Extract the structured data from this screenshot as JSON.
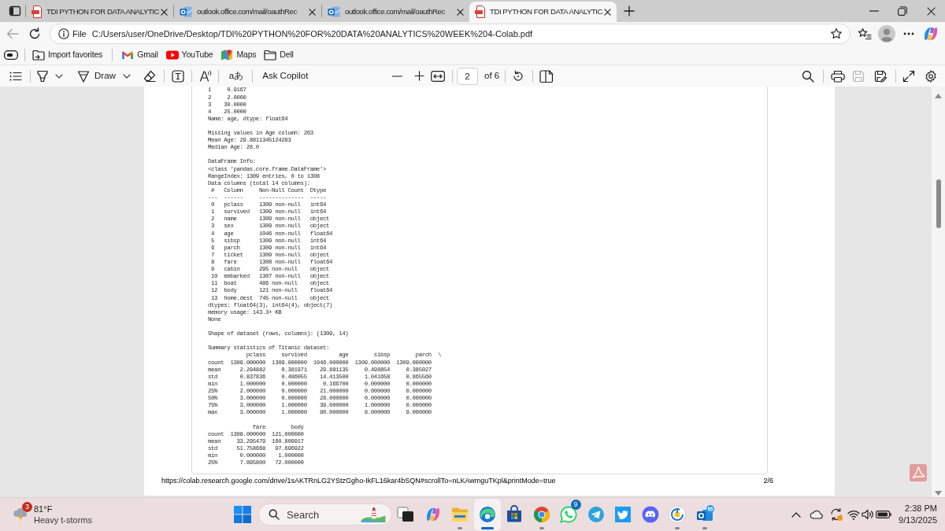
{
  "tabs": [
    {
      "kind": "pdf",
      "title": "TDI PYTHON FOR DATA ANALYTIC",
      "selected": false
    },
    {
      "kind": "mail",
      "title": "outlook.office.com/mail/oauthRec",
      "selected": false
    },
    {
      "kind": "mail",
      "title": "outlook.office.com/mail/oauthRec",
      "selected": false
    },
    {
      "kind": "pdf",
      "title": "TDI PYTHON FOR DATA ANALYTIC",
      "selected": true
    }
  ],
  "address_bar": {
    "back_disabled": true,
    "scheme": "File",
    "url": "C:/Users/user/OneDrive/Desktop/TDI%20PYTHON%20FOR%20DATA%20ANALYTICS%20WEEK%204-Colab.pdf"
  },
  "favorites_bar": [
    {
      "kind": "import",
      "label": "Import favorites"
    },
    {
      "kind": "gmail",
      "label": "Gmail"
    },
    {
      "kind": "youtube",
      "label": "YouTube"
    },
    {
      "kind": "maps",
      "label": "Maps"
    },
    {
      "kind": "folder",
      "label": "Dell"
    }
  ],
  "pdf_toolbar": {
    "draw_label": "Draw",
    "translate_label": "aあ",
    "copilot_label": "Ask Copilot",
    "page_number": "2",
    "page_total": "of 6",
    "save_disabled": true
  },
  "pdf_page": {
    "output_blocks": [
      {
        "lines": [
          "1     0.9167",
          "2     2.0000",
          "3    30.0000",
          "4    25.0000",
          "Name: age, dtype: float64"
        ]
      },
      {
        "lines": [
          "Missing values in Age column: 263",
          "Mean Age: 29.8811345124283",
          "Median Age: 28.0"
        ]
      },
      {
        "lines": [
          "DataFrame Info:",
          "<class 'pandas.core.frame.DataFrame'>",
          "RangeIndex: 1309 entries, 0 to 1308",
          "Data columns (total 14 columns):",
          " #   Column     Non-Null Count  Dtype",
          "---  ------     --------------  -----",
          " 0   pclass     1309 non-null   int64",
          " 1   survived   1309 non-null   int64",
          " 2   name       1309 non-null   object",
          " 3   sex        1309 non-null   object",
          " 4   age        1046 non-null   float64",
          " 5   sibsp      1309 non-null   int64",
          " 6   parch      1309 non-null   int64",
          " 7   ticket     1309 non-null   object",
          " 8   fare       1308 non-null   float64",
          " 9   cabin      295 non-null    object",
          " 10  embarked   1307 non-null   object",
          " 11  boat       486 non-null    object",
          " 12  body       121 non-null    float64",
          " 13  home.dest  745 non-null    object",
          "dtypes: float64(3), int64(4), object(7)",
          "memory usage: 143.3+ KB",
          "None"
        ]
      },
      {
        "lines": [
          "Shape of dataset (rows, columns): (1309, 14)"
        ]
      },
      {
        "lines": [
          "Summary statistics of Titanic dataset:",
          "            pclass     survived          age        sibsp        parch  \\",
          "count  1309.000000  1309.000000  1046.000000  1309.000000  1309.000000",
          "mean      2.294882     0.381971    29.881135     0.498854     0.385027",
          "std       0.837836     0.486055    14.413500     1.041658     0.865560",
          "min       1.000000     0.000000     0.166700     0.000000     0.000000",
          "25%       2.000000     0.000000    21.000000     0.000000     0.000000",
          "50%       3.000000     0.000000    28.000000     0.000000     0.000000",
          "75%       3.000000     1.000000    39.000000     1.000000     0.000000",
          "max       3.000000     1.000000    80.000000     8.000000     9.000000"
        ]
      },
      {
        "lines": [
          "              fare        body",
          "count  1308.000000  121.000000",
          "mean     33.295479  160.809917",
          "std      51.758668   97.696922",
          "min       0.000000    1.000000",
          "25%       7.895800   72.000000"
        ]
      }
    ],
    "footer_url": "https://colab.research.google.com/drive/1sAKTRnLG2YStzGgho-IkFL16kar4bSQN#scrollTo=nLKAwmguTKpl&printMode=true",
    "page_label": "2/6"
  },
  "taskbar": {
    "weather": {
      "badge": "3",
      "temperature": "81°F",
      "condition": "Heavy t-storms"
    },
    "search": {
      "placeholder": "Search"
    },
    "apps": [
      {
        "kind": "task-view",
        "running": false,
        "selected": false
      },
      {
        "kind": "copilot",
        "running": false,
        "selected": false
      },
      {
        "kind": "files",
        "running": true,
        "selected": false
      },
      {
        "kind": "edge",
        "running": true,
        "selected": true
      },
      {
        "kind": "store",
        "running": false,
        "selected": false
      },
      {
        "kind": "chrome",
        "running": true,
        "selected": false
      },
      {
        "kind": "whatsapp",
        "running": false,
        "selected": false,
        "badge": "9"
      },
      {
        "kind": "telegram",
        "running": false,
        "selected": false
      },
      {
        "kind": "twitter",
        "running": false,
        "selected": false
      },
      {
        "kind": "discord",
        "running": false,
        "selected": false
      },
      {
        "kind": "ring",
        "running": true,
        "selected": false
      },
      {
        "kind": "outlook",
        "running": true,
        "selected": false
      }
    ],
    "clock": {
      "time": "2:38 PM",
      "date": "9/13/2025"
    }
  }
}
